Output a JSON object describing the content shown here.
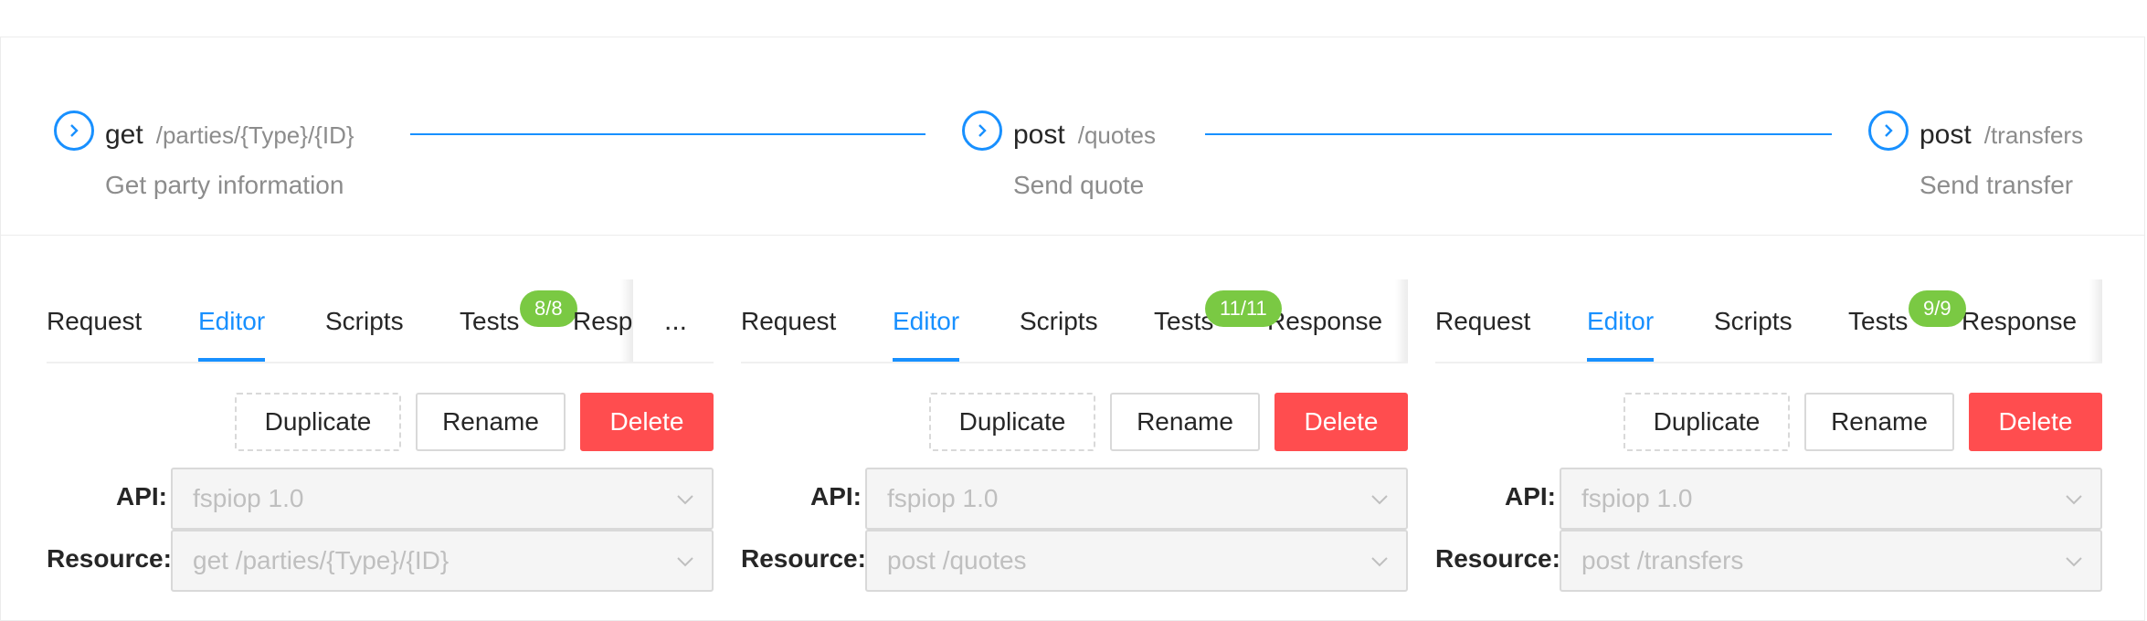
{
  "steps": [
    {
      "method": "get",
      "path": "/parties/{Type}/{ID}",
      "description": "Get party information"
    },
    {
      "method": "post",
      "path": "/quotes",
      "description": "Send quote"
    },
    {
      "method": "post",
      "path": "/transfers",
      "description": "Send transfer"
    }
  ],
  "panels": [
    {
      "tabs": {
        "request": "Request",
        "editor": "Editor",
        "scripts": "Scripts",
        "tests": "Tests",
        "response": "Response"
      },
      "tests_badge": "8/8",
      "more": "...",
      "buttons": {
        "duplicate": "Duplicate",
        "rename": "Rename",
        "delete": "Delete"
      },
      "api_label": "API:",
      "api_value": "fspiop 1.0",
      "resource_label": "Resource:",
      "resource_value": "get /parties/{Type}/{ID}"
    },
    {
      "tabs": {
        "request": "Request",
        "editor": "Editor",
        "scripts": "Scripts",
        "tests": "Tests",
        "response": "Response"
      },
      "tests_badge": "11/11",
      "buttons": {
        "duplicate": "Duplicate",
        "rename": "Rename",
        "delete": "Delete"
      },
      "api_label": "API:",
      "api_value": "fspiop 1.0",
      "resource_label": "Resource:",
      "resource_value": "post /quotes"
    },
    {
      "tabs": {
        "request": "Request",
        "editor": "Editor",
        "scripts": "Scripts",
        "tests": "Tests",
        "response": "Response"
      },
      "tests_badge": "9/9",
      "buttons": {
        "duplicate": "Duplicate",
        "rename": "Rename",
        "delete": "Delete"
      },
      "api_label": "API:",
      "api_value": "fspiop 1.0",
      "resource_label": "Resource:",
      "resource_value": "post /transfers"
    }
  ],
  "colors": {
    "accent": "#1890ff",
    "danger": "#ff4d4f",
    "badge": "#7ac943"
  },
  "icons": {
    "step": "chevron-right-circle-icon",
    "select": "chevron-down-icon"
  }
}
